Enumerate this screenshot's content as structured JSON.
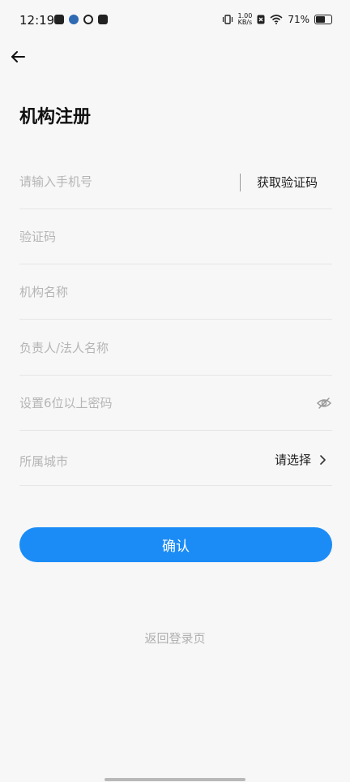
{
  "status_bar": {
    "time": "12:19",
    "net_speed_value": "1.00",
    "net_speed_unit": "KB/s",
    "battery": "71%",
    "battery_level": 0.71
  },
  "page": {
    "title": "机构注册"
  },
  "form": {
    "phone_placeholder": "请输入手机号",
    "get_code_label": "获取验证码",
    "code_placeholder": "验证码",
    "org_name_placeholder": "机构名称",
    "person_placeholder": "负责人/法人名称",
    "password_placeholder": "设置6位以上密码",
    "city_label": "所属城市",
    "city_value": "请选择"
  },
  "actions": {
    "confirm_label": "确认",
    "back_login_label": "返回登录页"
  },
  "colors": {
    "primary": "#1b8cf6",
    "background": "#f7f7f7",
    "placeholder": "#b5b5b5"
  }
}
